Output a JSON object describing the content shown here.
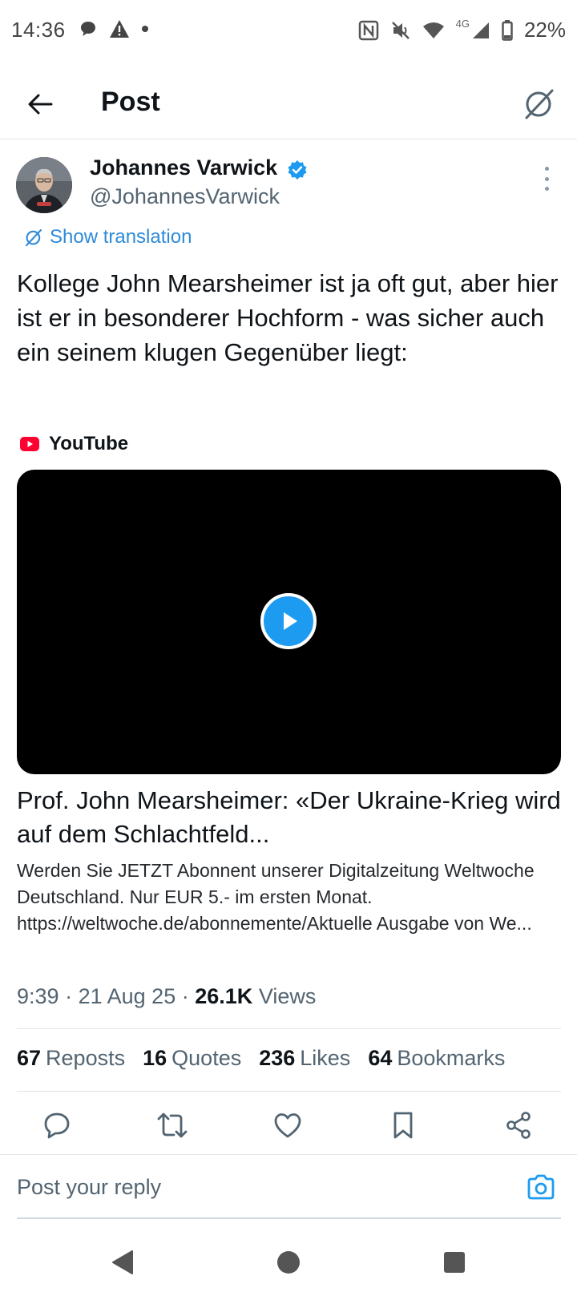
{
  "status_bar": {
    "time": "14:36",
    "network": "4G",
    "battery": "22%",
    "left_icons": [
      "chat-bubble-icon",
      "warning-icon",
      "dot-icon"
    ],
    "right_icons": [
      "nfc-icon",
      "mute-icon",
      "wifi-icon",
      "signal-icon",
      "battery-icon"
    ]
  },
  "header": {
    "title": "Post",
    "back_icon": "arrow-left-icon",
    "grok_icon": "grok-icon"
  },
  "post": {
    "author_name": "Johannes Varwick",
    "author_handle": "@JohannesVarwick",
    "verified": true,
    "show_translation": "Show translation",
    "text": "Kollege John Mearsheimer ist ja oft gut, aber hier ist er in besonderer Hochform - was sicher auch ein seinem klugen Gegenüber liegt:",
    "card": {
      "source": "YouTube",
      "title": "Prof. John Mearsheimer: «Der Ukraine-Krieg wird auf dem Schlachtfeld...",
      "description": "Werden Sie JETZT Abonnent unserer Digitalzeitung Weltwoche Deutschland. Nur EUR 5.- im ersten Monat. https://weltwoche.de/abonnemente/Aktuelle Ausgabe von We..."
    },
    "time": "9:39",
    "sep1": "·",
    "date": "21 Aug 25",
    "sep2": "·",
    "views_count": "26.1K",
    "views_label": "Views"
  },
  "stats": {
    "reposts_count": "67",
    "reposts_label": "Reposts",
    "quotes_count": "16",
    "quotes_label": "Quotes",
    "likes_count": "236",
    "likes_label": "Likes",
    "bookmarks_count": "64",
    "bookmarks_label": "Bookmarks"
  },
  "reply": {
    "placeholder": "Post your reply"
  },
  "colors": {
    "accent": "#1d9bf0",
    "text_primary": "#0f1419",
    "text_secondary": "#536471",
    "youtube_red": "#ff0033"
  }
}
